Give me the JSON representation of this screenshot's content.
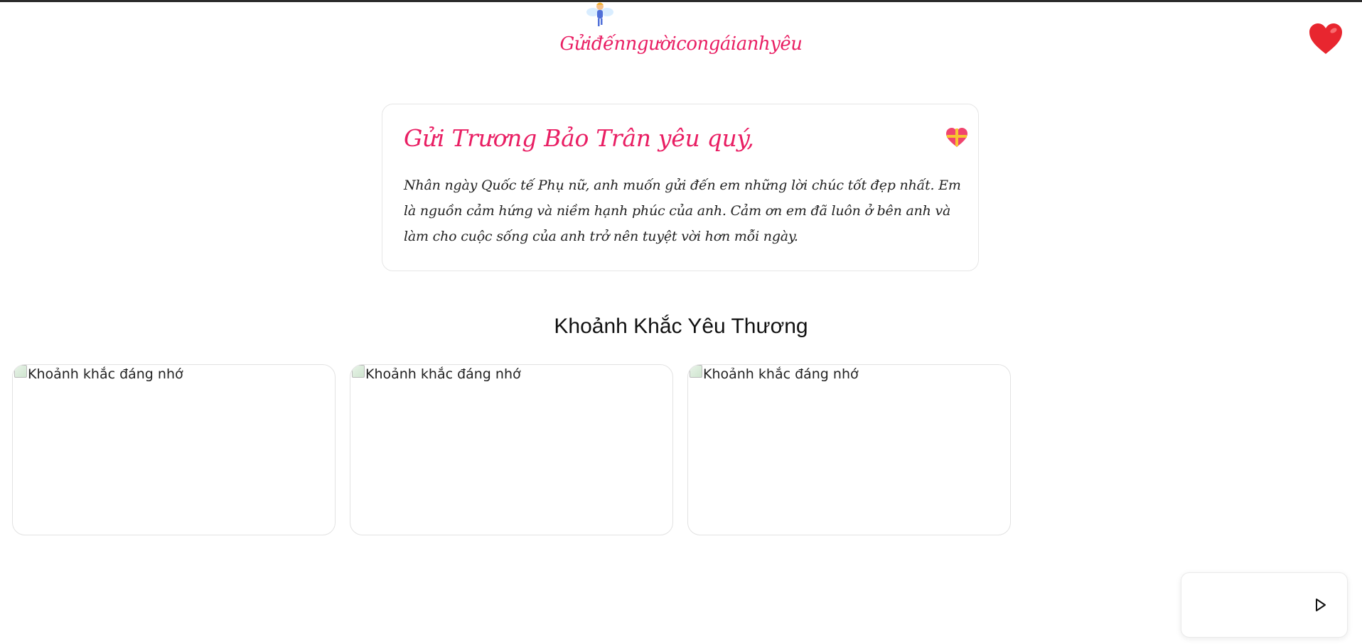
{
  "header": {
    "title": "Gửiđếnngườicongáianhyêu",
    "fairy_icon": "fairy-icon",
    "heart_icon": "red-heart-icon"
  },
  "letter": {
    "greeting": "Gửi Trương Bảo Trân yêu quý,",
    "body": "Nhân ngày Quốc tế Phụ nữ, anh muốn gửi đến em những lời chúc tốt đẹp nhất. Em là nguồn cảm hứng và niềm hạnh phúc của anh. Cảm ơn em đã luôn ở bên anh và làm cho cuộc sống của anh trở nên tuyệt vời hơn mỗi ngày.",
    "icon": "gift-heart-icon"
  },
  "gallery": {
    "title": "Khoảnh Khắc Yêu Thương",
    "items": [
      {
        "alt": "Khoảnh khắc đáng nhớ"
      },
      {
        "alt": "Khoảnh khắc đáng nhớ"
      },
      {
        "alt": "Khoảnh khắc đáng nhớ"
      }
    ]
  },
  "music_player": {
    "play_icon": "play-icon"
  },
  "colors": {
    "accent": "#e91e63",
    "heart": "#e8262f",
    "top_bar": "#2b2b2b"
  }
}
